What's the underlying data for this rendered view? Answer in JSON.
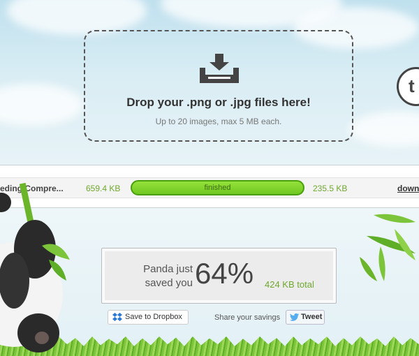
{
  "dropzone": {
    "headline": "Drop your .png or .jpg files here!",
    "subline": "Up to 20 images, max 5 MB each."
  },
  "twitter_badge": {
    "glyph": "t"
  },
  "file_row": {
    "filename": "eding Compre...",
    "original_size": "659.4 KB",
    "status": "finished",
    "progress": 1.0,
    "new_size": "235.5 KB",
    "download_label": "down"
  },
  "savings": {
    "label": "Panda just saved you",
    "percent": "64%",
    "total": "424 KB total"
  },
  "share": {
    "dropbox_label": "Save to Dropbox",
    "share_label": "Share your savings",
    "tweet_label": "Tweet"
  },
  "colors": {
    "accent_green": "#6fa82d",
    "progress_green": "#7ed42a",
    "twitter_blue": "#55acee",
    "dropbox_blue": "#2d7ad6"
  }
}
